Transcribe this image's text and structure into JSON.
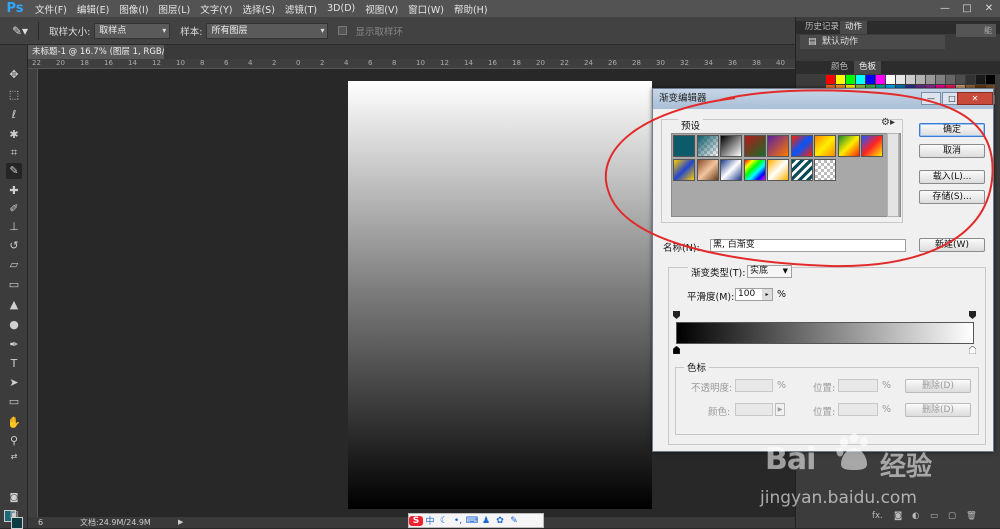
{
  "menubar": {
    "logo": "Ps",
    "items": [
      "文件(F)",
      "编辑(E)",
      "图像(I)",
      "图层(L)",
      "文字(Y)",
      "选择(S)",
      "滤镜(T)",
      "3D(D)",
      "视图(V)",
      "窗口(W)",
      "帮助(H)"
    ],
    "win_min": "—",
    "win_max": "□",
    "win_close": "✕"
  },
  "options": {
    "sample_size_label": "取样大小:",
    "sample_size_value": "取样点",
    "sample_label": "样本:",
    "sample_value": "所有图层",
    "show_ring_label": "显示取样环"
  },
  "document": {
    "tab_title": "未标题-1 @ 16.7% (图层 1, RGB/8) *",
    "tab_close": "×",
    "status": "文档:24.9M/24.9M",
    "zoom_fragment": "6"
  },
  "rulers": {
    "top_ticks": [
      "22",
      "20",
      "18",
      "16",
      "14",
      "12",
      "10",
      "8",
      "6",
      "4",
      "2",
      "0",
      "2",
      "4",
      "6",
      "8",
      "10",
      "12",
      "14",
      "16",
      "18",
      "20",
      "22",
      "24",
      "26",
      "28",
      "30",
      "32",
      "34",
      "36",
      "38",
      "40",
      "42",
      "44"
    ]
  },
  "panels": {
    "history_tab": "历史记录",
    "actions_tab": "动作",
    "default_action": "默认动作",
    "color_tab": "颜色",
    "swatches_tab": "色板",
    "top_right_text": "能",
    "fx_label": "fx."
  },
  "dialog": {
    "title": "渐变编辑器",
    "presets_label": "预设",
    "ok": "确定",
    "cancel": "取消",
    "load": "载入(L)...",
    "save": "存储(S)...",
    "name_label": "名称(N):",
    "name_value": "黑, 白渐变",
    "new": "新建(W)",
    "type_label": "渐变类型(T):",
    "type_value": "实底",
    "smooth_label": "平滑度(M):",
    "smooth_value": "100",
    "smooth_unit": "%",
    "stops_group": "色标",
    "opacity_label": "不透明度:",
    "opacity_unit": "%",
    "location_label": "位置:",
    "location_unit": "%",
    "delete": "删除(D)",
    "color_label": "颜色:"
  },
  "watermark": {
    "text1": "Bai",
    "text2": "经验",
    "url": "jingyan.baidu.com"
  },
  "ime": {
    "logo": "S",
    "mode": "中"
  }
}
